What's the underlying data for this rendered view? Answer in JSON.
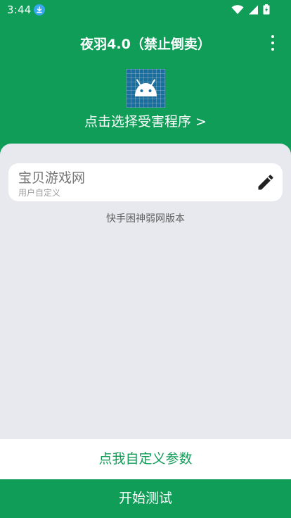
{
  "status_bar": {
    "time": "3:44",
    "icons": [
      "download-icon",
      "wifi-icon",
      "cellular-signal-icon",
      "battery-icon"
    ]
  },
  "app_bar": {
    "title": "夜羽4.0（禁止倒卖）",
    "menu_icon": "more-vert-icon"
  },
  "app_picker": {
    "icon": "android-app-icon",
    "label": "点击选择受害程序 >"
  },
  "target": {
    "name": "宝贝游戏网",
    "subtitle": "用户自定义",
    "edit_icon": "pencil-icon"
  },
  "version_note": "快手困神弱网版本",
  "actions": {
    "custom_params_label": "点我自定义参数",
    "start_label": "开始测试"
  },
  "colors": {
    "primary_green": "#0f9d58",
    "panel_background": "#e8e9ee",
    "card_background": "#ffffff",
    "download_badge": "#37a8f0"
  }
}
